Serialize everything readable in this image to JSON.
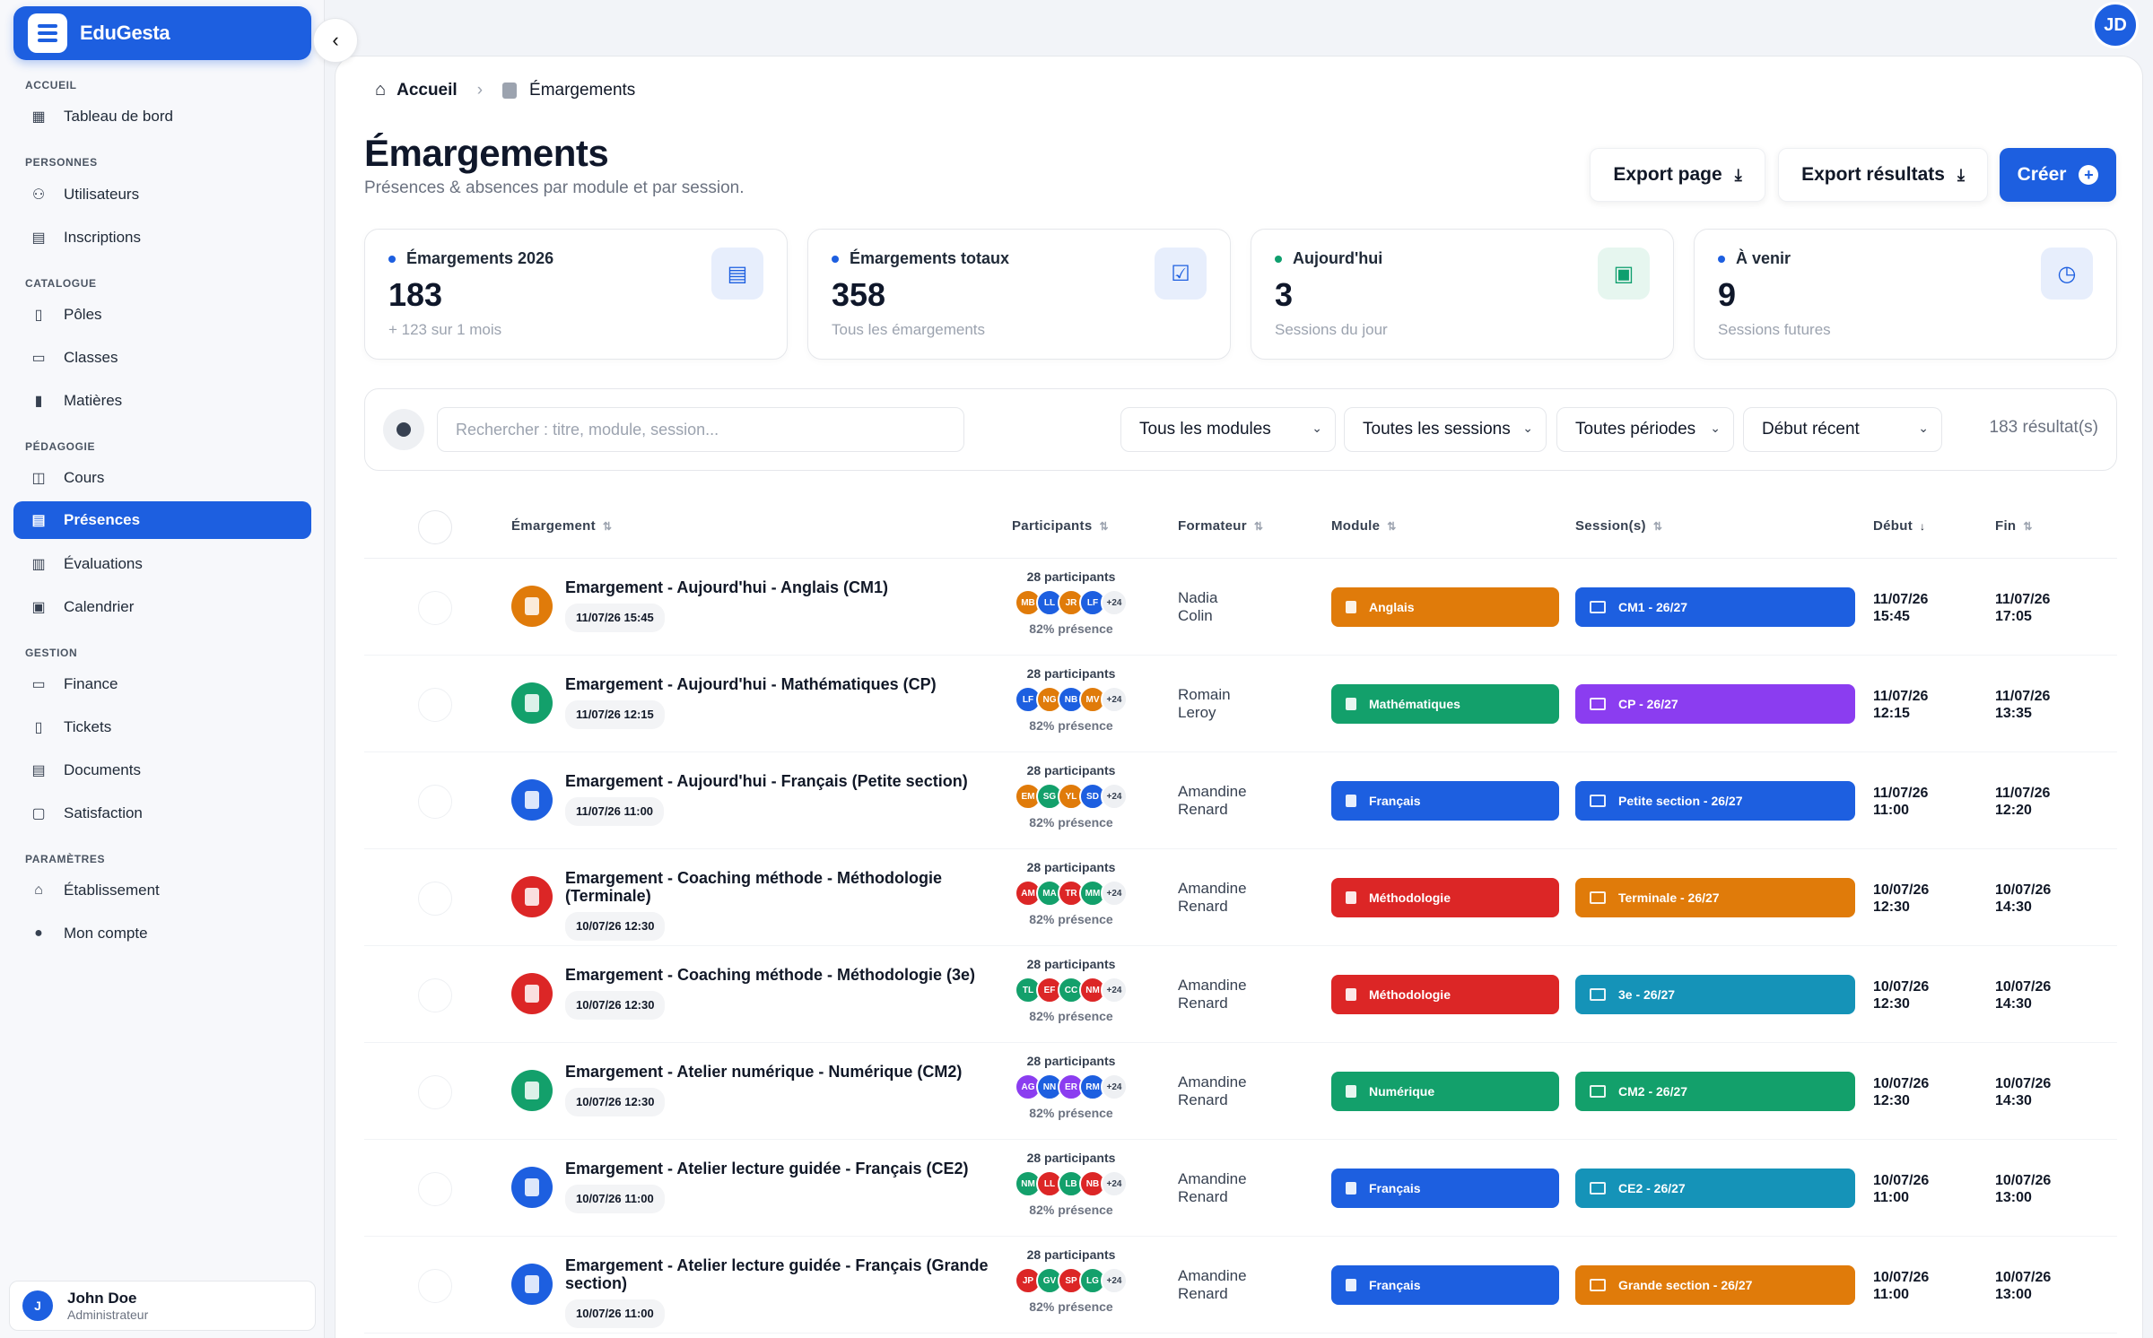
{
  "app": {
    "name": "EduGesta"
  },
  "top_user": {
    "initials": "JD"
  },
  "sidebar": {
    "sections": {
      "accueil": "ACCUEIL",
      "personnes": "PERSONNES",
      "catalogue": "CATALOGUE",
      "pedagogie": "PÉDAGOGIE",
      "gestion": "GESTION",
      "parametres": "PARAMÈTRES"
    },
    "items": {
      "tableau": "Tableau de bord",
      "utilisateurs": "Utilisateurs",
      "inscriptions": "Inscriptions",
      "poles": "Pôles",
      "classes": "Classes",
      "matieres": "Matières",
      "cours": "Cours",
      "presences": "Présences",
      "evaluations": "Évaluations",
      "calendrier": "Calendrier",
      "finance": "Finance",
      "tickets": "Tickets",
      "documents": "Documents",
      "satisfaction": "Satisfaction",
      "etablissement": "Établissement",
      "compte": "Mon compte"
    },
    "user": {
      "initial": "J",
      "name": "John Doe",
      "role": "Administrateur"
    }
  },
  "breadcrumb": {
    "home": "Accueil",
    "current": "Émargements"
  },
  "header": {
    "title": "Émargements",
    "subtitle": "Présences & absences par module et par session.",
    "export_page": "Export page",
    "export_results": "Export résultats",
    "create": "Créer"
  },
  "stats": [
    {
      "label": "Émargements 2026",
      "value": "183",
      "sub": "+ 123 sur 1 mois",
      "dot": "#1d5fe0"
    },
    {
      "label": "Émargements totaux",
      "value": "358",
      "sub": "Tous les émargements",
      "dot": "#1d5fe0"
    },
    {
      "label": "Aujourd'hui",
      "value": "3",
      "sub": "Sessions du jour",
      "dot": "#0f9f6e"
    },
    {
      "label": "À venir",
      "value": "9",
      "sub": "Sessions futures",
      "dot": "#1d5fe0"
    }
  ],
  "filters": {
    "search_placeholder": "Rechercher : titre, module, session...",
    "modules": "Tous les modules",
    "sessions": "Toutes les sessions",
    "periodes": "Toutes périodes",
    "tri": "Début récent",
    "results": "183 résultat(s)"
  },
  "table": {
    "headers": {
      "emargement": "Émargement",
      "participants": "Participants",
      "formateur": "Formateur",
      "module": "Module",
      "sessions": "Session(s)",
      "debut": "Début",
      "fin": "Fin"
    },
    "rows": [
      {
        "title": "Emargement - Aujourd'hui - Anglais (CM1)",
        "date": "11/07/26 15:45",
        "icon_color": "#e07b0a",
        "participants": "28 participants",
        "avatars": [
          [
            "MB",
            "#e07b0a"
          ],
          [
            "LL",
            "#1d5fe0"
          ],
          [
            "JR",
            "#e07b0a"
          ],
          [
            "LF",
            "#1d5fe0"
          ]
        ],
        "more": "+24",
        "presence": "82% présence",
        "former_first": "Nadia",
        "former_last": "Colin",
        "module": "Anglais",
        "module_color": "#e07b0a",
        "session": "CM1 - 26/27",
        "session_color": "#1d5fe0",
        "start_date": "11/07/26",
        "start_time": "15:45",
        "end_date": "11/07/26",
        "end_time": "17:05"
      },
      {
        "title": "Emargement - Aujourd'hui - Mathématiques (CP)",
        "date": "11/07/26 12:15",
        "icon_color": "#13a06b",
        "participants": "28 participants",
        "avatars": [
          [
            "LF",
            "#1d5fe0"
          ],
          [
            "NG",
            "#e07b0a"
          ],
          [
            "NB",
            "#1d5fe0"
          ],
          [
            "MV",
            "#e07b0a"
          ]
        ],
        "more": "+24",
        "presence": "82% présence",
        "former_first": "Romain",
        "former_last": "Leroy",
        "module": "Mathématiques",
        "module_color": "#13a06b",
        "session": "CP - 26/27",
        "session_color": "#8b3df0",
        "start_date": "11/07/26",
        "start_time": "12:15",
        "end_date": "11/07/26",
        "end_time": "13:35"
      },
      {
        "title": "Emargement - Aujourd'hui - Français (Petite section)",
        "date": "11/07/26 11:00",
        "icon_color": "#1d5fe0",
        "participants": "28 participants",
        "avatars": [
          [
            "EM",
            "#e07b0a"
          ],
          [
            "SG",
            "#13a06b"
          ],
          [
            "YL",
            "#e07b0a"
          ],
          [
            "SD",
            "#1d5fe0"
          ]
        ],
        "more": "+24",
        "presence": "82% présence",
        "former_first": "Amandine",
        "former_last": "Renard",
        "module": "Français",
        "module_color": "#1d5fe0",
        "session": "Petite section - 26/27",
        "session_color": "#1d5fe0",
        "start_date": "11/07/26",
        "start_time": "11:00",
        "end_date": "11/07/26",
        "end_time": "12:20"
      },
      {
        "title": "Emargement - Coaching méthode - Méthodologie (Terminale)",
        "date": "10/07/26 12:30",
        "icon_color": "#dc2626",
        "participants": "28 participants",
        "avatars": [
          [
            "AM",
            "#dc2626"
          ],
          [
            "MA",
            "#13a06b"
          ],
          [
            "TR",
            "#dc2626"
          ],
          [
            "MM",
            "#13a06b"
          ]
        ],
        "more": "+24",
        "presence": "82% présence",
        "former_first": "Amandine",
        "former_last": "Renard",
        "module": "Méthodologie",
        "module_color": "#dc2626",
        "session": "Terminale - 26/27",
        "session_color": "#e07b0a",
        "start_date": "10/07/26",
        "start_time": "12:30",
        "end_date": "10/07/26",
        "end_time": "14:30"
      },
      {
        "title": "Emargement - Coaching méthode - Méthodologie (3e)",
        "date": "10/07/26 12:30",
        "icon_color": "#dc2626",
        "participants": "28 participants",
        "avatars": [
          [
            "TL",
            "#13a06b"
          ],
          [
            "EF",
            "#dc2626"
          ],
          [
            "CC",
            "#13a06b"
          ],
          [
            "NM",
            "#dc2626"
          ]
        ],
        "more": "+24",
        "presence": "82% présence",
        "former_first": "Amandine",
        "former_last": "Renard",
        "module": "Méthodologie",
        "module_color": "#dc2626",
        "session": "3e - 26/27",
        "session_color": "#1593b8",
        "start_date": "10/07/26",
        "start_time": "12:30",
        "end_date": "10/07/26",
        "end_time": "14:30"
      },
      {
        "title": "Emargement - Atelier numérique - Numérique (CM2)",
        "date": "10/07/26 12:30",
        "icon_color": "#13a06b",
        "participants": "28 participants",
        "avatars": [
          [
            "AG",
            "#8b3df0"
          ],
          [
            "NN",
            "#1d5fe0"
          ],
          [
            "ER",
            "#8b3df0"
          ],
          [
            "RM",
            "#1d5fe0"
          ]
        ],
        "more": "+24",
        "presence": "82% présence",
        "former_first": "Amandine",
        "former_last": "Renard",
        "module": "Numérique",
        "module_color": "#13a06b",
        "session": "CM2 - 26/27",
        "session_color": "#13a06b",
        "start_date": "10/07/26",
        "start_time": "12:30",
        "end_date": "10/07/26",
        "end_time": "14:30"
      },
      {
        "title": "Emargement - Atelier lecture guidée - Français (CE2)",
        "date": "10/07/26 11:00",
        "icon_color": "#1d5fe0",
        "participants": "28 participants",
        "avatars": [
          [
            "NM",
            "#13a06b"
          ],
          [
            "LL",
            "#dc2626"
          ],
          [
            "LB",
            "#13a06b"
          ],
          [
            "NB",
            "#dc2626"
          ]
        ],
        "more": "+24",
        "presence": "82% présence",
        "former_first": "Amandine",
        "former_last": "Renard",
        "module": "Français",
        "module_color": "#1d5fe0",
        "session": "CE2 - 26/27",
        "session_color": "#1593b8",
        "start_date": "10/07/26",
        "start_time": "11:00",
        "end_date": "10/07/26",
        "end_time": "13:00"
      },
      {
        "title": "Emargement - Atelier lecture guidée - Français (Grande section)",
        "date": "10/07/26 11:00",
        "icon_color": "#1d5fe0",
        "participants": "28 participants",
        "avatars": [
          [
            "JP",
            "#dc2626"
          ],
          [
            "GV",
            "#13a06b"
          ],
          [
            "SP",
            "#dc2626"
          ],
          [
            "LG",
            "#13a06b"
          ]
        ],
        "more": "+24",
        "presence": "82% présence",
        "former_first": "Amandine",
        "former_last": "Renard",
        "module": "Français",
        "module_color": "#1d5fe0",
        "session": "Grande section - 26/27",
        "session_color": "#e07b0a",
        "start_date": "10/07/26",
        "start_time": "11:00",
        "end_date": "10/07/26",
        "end_time": "13:00"
      }
    ]
  }
}
